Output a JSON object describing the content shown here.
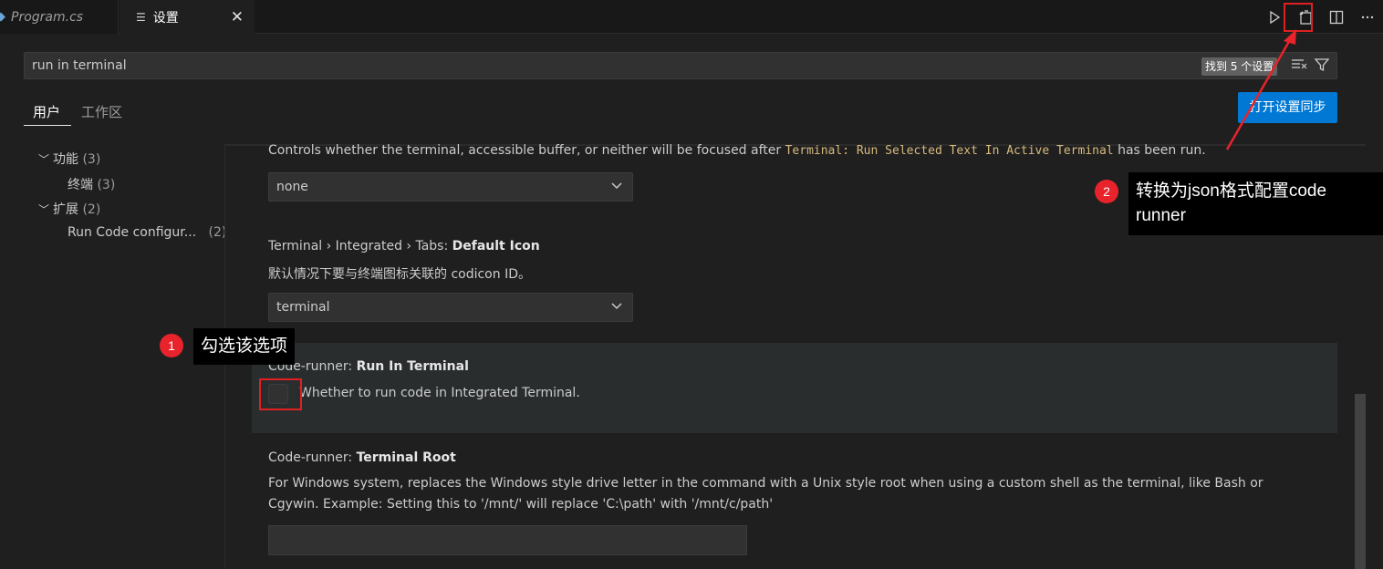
{
  "tabs": {
    "program": {
      "icon": "csharp-file-icon",
      "label": "Program.cs"
    },
    "settings": {
      "icon": "settings-editor-icon",
      "label": "设置",
      "close": "✕"
    }
  },
  "toolbar": {
    "icons": [
      "run-icon",
      "open-settings-json-icon",
      "split-editor-icon",
      "more-actions-icon"
    ]
  },
  "search": {
    "value": "run in terminal",
    "result_badge": "找到 5 个设置"
  },
  "scope": {
    "user": "用户",
    "workspace": "工作区",
    "sync_button": "打开设置同步"
  },
  "tree": [
    {
      "label": "功能",
      "count": "(3)",
      "expanded": true
    },
    {
      "label": "终端",
      "count": "(3)"
    },
    {
      "label": "扩展",
      "count": "(2)",
      "expanded": true
    },
    {
      "label": "Run Code configur...",
      "count": "(2)"
    }
  ],
  "settings": {
    "focus_desc_pre": "Controls whether the terminal, accessible buffer, or neither will be focused after ",
    "focus_desc_code": "Terminal: Run Selected Text In Active Terminal",
    "focus_desc_post": " has been run.",
    "focus_value": "none",
    "icon_title_prefix": "Terminal › Integrated › Tabs: ",
    "icon_title_name": "Default Icon",
    "icon_desc": "默认情况下要与终端图标关联的 codicon ID。",
    "icon_value": "terminal",
    "run_title_prefix": "Code-runner: ",
    "run_title_name": "Run In Terminal",
    "run_desc": "Whether to run code in Integrated Terminal.",
    "run_checked": false,
    "root_title_prefix": "Code-runner: ",
    "root_title_name": "Terminal Root",
    "root_desc_1": "For Windows system, replaces the Windows style drive letter in the command with a Unix style root when using a custom shell as the terminal, like Bash or",
    "root_desc_2": "Cgywin. Example: Setting this to '/mnt/' will replace 'C:\\path' with '/mnt/c/path'",
    "root_value": ""
  },
  "annotations": {
    "one_num": "1",
    "one_text": "勾选该选项",
    "two_num": "2",
    "two_text_1": "转换为json格式配置code",
    "two_text_2": "runner",
    "highlight_color": "#e02020"
  }
}
